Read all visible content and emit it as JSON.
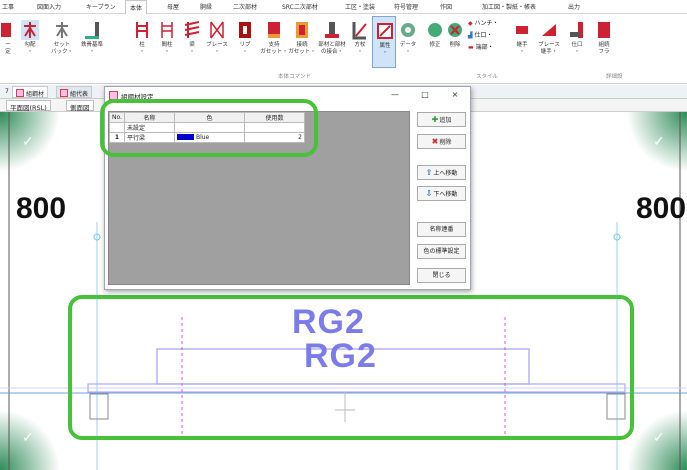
{
  "menu_tabs": [
    "工事",
    "図面入力",
    "キープラン",
    "本体",
    "母屋",
    "胴縁",
    "二次部材",
    "SRC二次部材",
    "工区・塗装",
    "符号管理",
    "作図",
    "加工図・製紙・帳表",
    "出力"
  ],
  "active_menu_tab": "本体",
  "ribbon": {
    "buttons": [
      {
        "label": "ー\n定",
        "icon": "partial-icon"
      },
      {
        "label": "勾配\n・",
        "icon": "slope-icon"
      },
      {
        "label": "セット\nバック・",
        "icon": "setback-icon"
      },
      {
        "label": "鉄骨基準\n・",
        "icon": "steel-base-icon"
      },
      {
        "label": "柱\n・",
        "icon": "column-icon"
      },
      {
        "label": "間柱\n・",
        "icon": "stud-icon"
      },
      {
        "label": "梁\n・",
        "icon": "beam-icon"
      },
      {
        "label": "ブレース\n・",
        "icon": "brace-icon"
      },
      {
        "label": "リブ\n・",
        "icon": "rib-icon"
      },
      {
        "label": "支持\nガセット・",
        "icon": "support-gusset-icon"
      },
      {
        "label": "接続\nガセット・",
        "icon": "connect-gusset-icon"
      },
      {
        "label": "部材と部材\nの接合・",
        "icon": "member-joint-icon"
      },
      {
        "label": "方杖\n・",
        "icon": "knee-brace-icon"
      },
      {
        "label": "属性\n・",
        "icon": "attribute-icon"
      },
      {
        "label": "データ\n・",
        "icon": "data-icon"
      },
      {
        "label": "修正",
        "icon": "modify-icon"
      },
      {
        "label": "削除",
        "icon": "delete-icon"
      },
      {
        "label": "継手\n・",
        "icon": "joint-icon"
      },
      {
        "label": "ブレース\n継手・",
        "icon": "brace-joint-icon"
      },
      {
        "label": "仕口\n・",
        "icon": "connection-icon"
      },
      {
        "label": "組続\nフラ",
        "icon": "assembly-icon"
      }
    ],
    "small_items": [
      "ハンチ・",
      "仕口・",
      "端部・"
    ],
    "group_labels": [
      "本体コマンド",
      "スタイル",
      "詳細設"
    ]
  },
  "doc_tabs": [
    {
      "label": "7"
    },
    {
      "label": "組鋼材"
    },
    {
      "label": "組代表"
    }
  ],
  "view_tabs": [
    "平面図(RSL)",
    "側面図"
  ],
  "canvas": {
    "dimension_left": "800",
    "dimension_right": "800",
    "member_label_top": "RG2",
    "member_label_bottom": "RG2"
  },
  "dialog": {
    "title": "組鋼材設定",
    "window_controls": {
      "minimize": "—",
      "maximize": "□",
      "close": "×"
    },
    "table": {
      "columns": [
        "No.",
        "名称",
        "色",
        "使用数"
      ],
      "rows": [
        {
          "no": "",
          "name": "未設定",
          "color": "",
          "count": ""
        },
        {
          "no": "1",
          "name": "平行梁",
          "color": "Blue",
          "count": "2"
        }
      ]
    },
    "buttons": {
      "add": "追加",
      "remove": "削除",
      "move_up": "上へ移動",
      "move_down": "下へ移動",
      "rename": "名称連番",
      "default_color": "色の標準設定",
      "close": "閉じる"
    }
  },
  "colors": {
    "highlight": "#46c138",
    "member_text": "#7b7bea",
    "swatch": "#0000cc",
    "corner_green": "#2e8b57"
  }
}
